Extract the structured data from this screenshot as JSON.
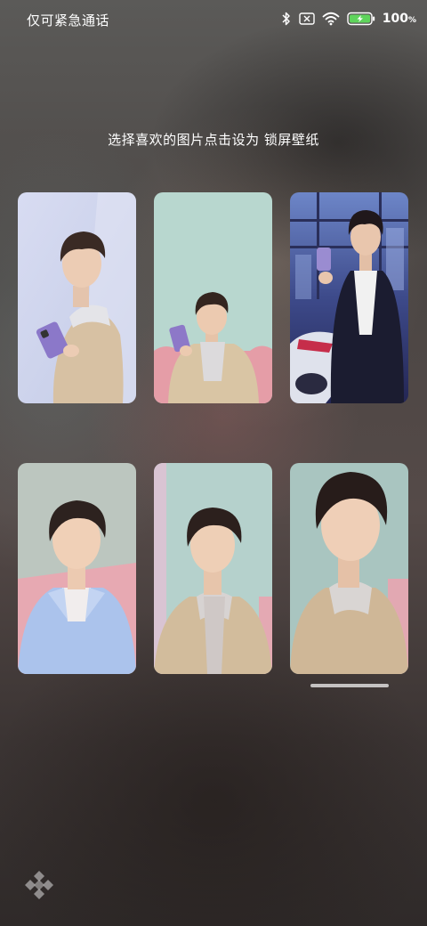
{
  "status_bar": {
    "left_text": "仅可紧急通话",
    "icons": [
      "bluetooth-icon",
      "no-sim-icon",
      "wifi-icon",
      "battery-charging-icon"
    ],
    "battery_percent": "100",
    "battery_unit": "%",
    "battery_color": "#5fd45c"
  },
  "instruction": "选择喜欢的图片点击设为 锁屏壁纸",
  "wallpapers": [
    {
      "icon": "portrait-holding-phone",
      "bg": "#cfd6ee"
    },
    {
      "icon": "portrait-sitting-pink-sofa",
      "bg": "#b6d4cc"
    },
    {
      "icon": "portrait-city-motorcycle",
      "bg": "#3a3f7e"
    },
    {
      "icon": "portrait-blue-shirt",
      "bg": "#b9c3bc"
    },
    {
      "icon": "portrait-beige-coat",
      "bg": "#b4cfca"
    },
    {
      "icon": "portrait-closeup",
      "bg": "#a9c3bf"
    }
  ],
  "corner_icon": "diamond-grid-icon"
}
